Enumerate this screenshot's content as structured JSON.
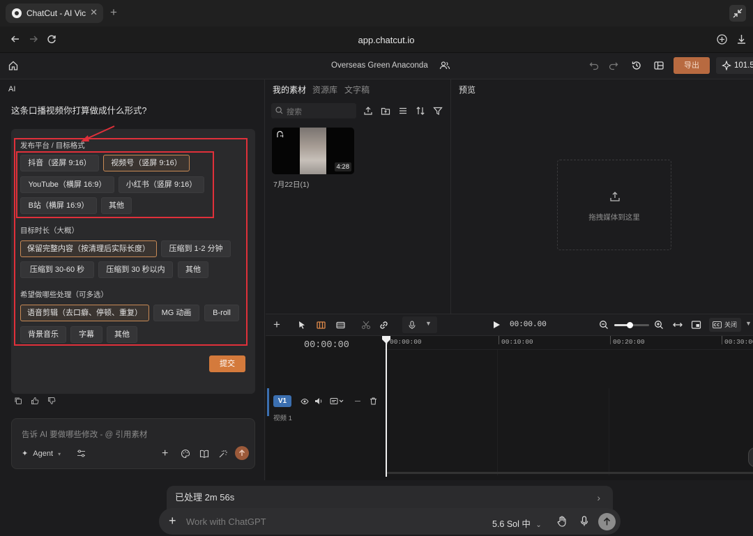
{
  "browser": {
    "tab_title": "ChatCut - AI Vic",
    "url": "app.chatcut.io"
  },
  "header": {
    "project_name": "Overseas Green Anaconda",
    "export_label": "导出",
    "credits": "101.5"
  },
  "ai_panel": {
    "label": "AI",
    "question": "这条口播视频你打算做成什么形式?",
    "sections": {
      "platform": {
        "title": "发布平台 / 目标格式",
        "options": [
          "抖音（竖屏 9:16）",
          "视频号（竖屏 9:16）",
          "YouTube（横屏 16:9）",
          "小红书（竖屏 9:16）",
          "B站（横屏 16:9）",
          "其他"
        ],
        "selected": "视频号（竖屏 9:16）"
      },
      "duration": {
        "title": "目标时长（大概）",
        "options": [
          "保留完整内容（按清理后实际长度）",
          "压缩到 1-2 分钟",
          "压缩到 30-60 秒",
          "压缩到 30 秒以内",
          "其他"
        ],
        "selected": "保留完整内容（按清理后实际长度）"
      },
      "processing": {
        "title": "希望做哪些处理（可多选）",
        "options": [
          "语音剪辑（去口癖、停顿、重复）",
          "MG 动画",
          "B-roll",
          "背景音乐",
          "字幕",
          "其他"
        ],
        "selected": "语音剪辑（去口癖、停顿、重复）"
      }
    },
    "submit_label": "提交",
    "composer_placeholder": "告诉 AI 要做哪些修改 - @ 引用素材",
    "agent_label": "Agent"
  },
  "media_panel": {
    "tabs": [
      "我的素材",
      "资源库",
      "文字稿"
    ],
    "active_tab": "我的素材",
    "search_placeholder": "搜索",
    "clip_duration": "4:28",
    "clip_date": "7月22日(1)"
  },
  "preview_panel": {
    "title": "预览",
    "drop_text": "拖拽媒体到这里"
  },
  "timeline": {
    "playback_time": "00:00.00",
    "timecode": "00:00:00",
    "ruler": [
      "00:00:00",
      "00:10:00",
      "00:20:00",
      "00:30:00"
    ],
    "caption_toggle": "关闭",
    "track_label": "V1",
    "track_name": "视频 1",
    "zoom_level": 0.45
  },
  "bottom_bar": {
    "processed": "已处理 2m 56s",
    "chat_placeholder": "Work with ChatGPT",
    "model": "5.6 Sol 中"
  },
  "colors": {
    "accent": "#d47a3c",
    "export": "#b86a40",
    "annotation": "#e0303a",
    "track": "#3b6fb0"
  }
}
